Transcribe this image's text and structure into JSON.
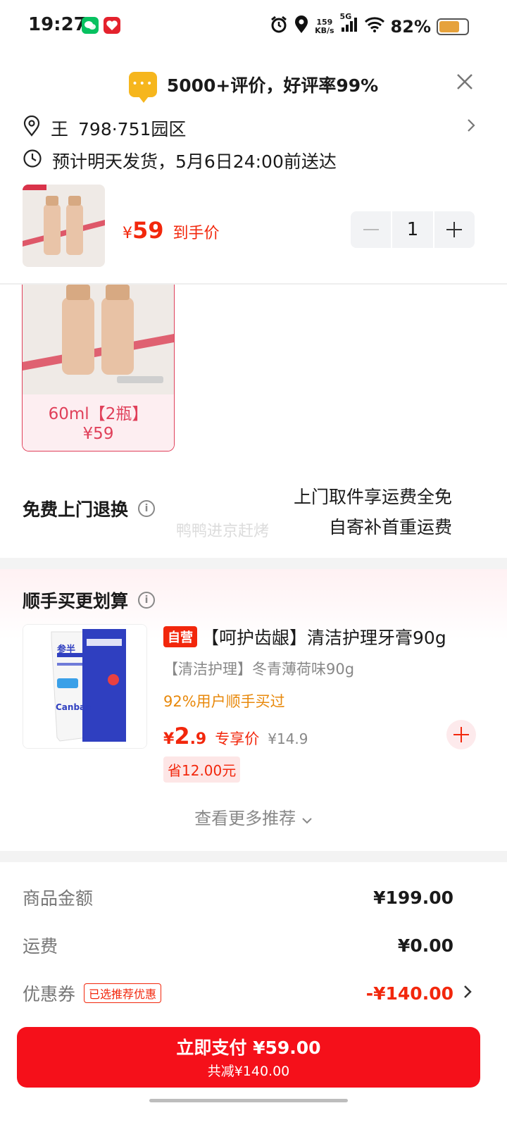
{
  "status_bar": {
    "time": "19:27",
    "net_speed_top": "159",
    "net_speed_bottom": "KB/s",
    "network": "5G",
    "battery": "82%",
    "battery_level": 0.82
  },
  "rating_banner": {
    "text": "5000+评价，好评率99%"
  },
  "address": {
    "name": "王",
    "location": "798·751园区"
  },
  "shipping": {
    "text": "预计明天发货，5月6日24:00前送达"
  },
  "product": {
    "price_symbol": "¥",
    "price": "59",
    "price_note": "到手价",
    "quantity": "1"
  },
  "variant": {
    "spec": "60ml【2瓶】",
    "price": "¥59"
  },
  "return_service": {
    "title": "免费上门退换",
    "line1": "上门取件享运费全免",
    "line2": "自寄补首重运费",
    "watermark": "鸭鸭进京赶烤"
  },
  "recommendation": {
    "title": "顺手买更划算",
    "item": {
      "tag": "自营",
      "name": "【呵护齿龈】清洁护理牙膏90g",
      "spec": "【清洁护理】冬青薄荷味90g",
      "buy_rate": "92%用户顺手买过",
      "price_symbol": "¥",
      "price_int": "2",
      "price_dec": ".9",
      "price_note": "专享价",
      "orig_price": "¥14.9",
      "save": "省12.00元",
      "brand_cn": "参半",
      "brand_en": "Canban"
    },
    "more": "查看更多推荐"
  },
  "summary": {
    "goods_label": "商品金额",
    "goods_value": "¥199.00",
    "freight_label": "运费",
    "freight_value": "¥0.00",
    "coupon_label": "优惠券",
    "coupon_tag": "已选推荐优惠",
    "coupon_value": "-¥140.00"
  },
  "pay": {
    "label": "立即支付 ¥59.00",
    "saved": "共减¥140.00"
  },
  "colors": {
    "accent": "#f2270c",
    "pay_button": "#f5101a",
    "rating_icon": "#f6b61d"
  }
}
